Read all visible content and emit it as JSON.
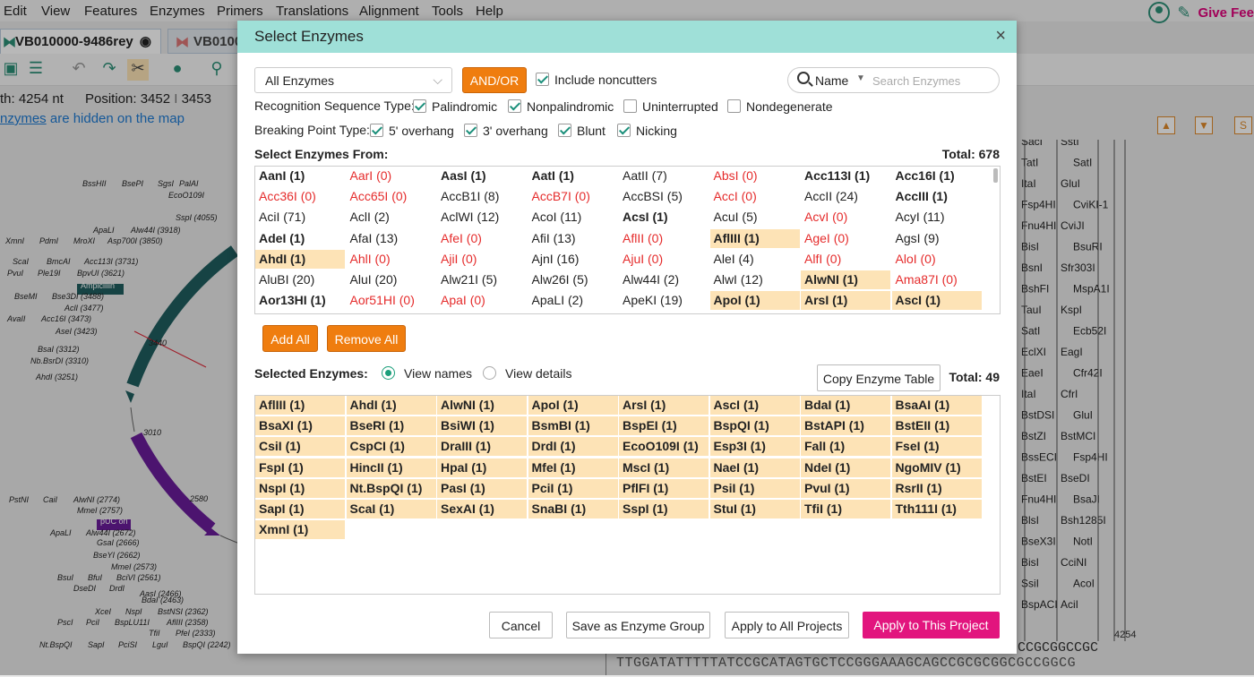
{
  "menu": [
    "Edit",
    "View",
    "Features",
    "Enzymes",
    "Primers",
    "Translations",
    "Alignment",
    "Tools",
    "Help"
  ],
  "header_right": {
    "feedback_label": "Give Fee"
  },
  "tabs": [
    "VB010000-9486rey",
    "VB0100"
  ],
  "info": {
    "length": "th: 4254 nt",
    "position": "Position: 3452",
    "position_end": "3453"
  },
  "hidden_notice": {
    "link": "nzymes",
    "rest": " are hidden on the map"
  },
  "sequence": {
    "bottom": "TTGGATATTTTTATCCGCATAGTGCTCCGGGAAAGCAGCCGCGCGGCGCCGGCG",
    "top_right": "CCGCGGCCGC",
    "length_label": "4254"
  },
  "dialog": {
    "title": "Select Enzymes",
    "close": "×",
    "dropdown_value": "All Enzymes",
    "andor_label": "AND/OR",
    "include_noncutters": "Include noncutters",
    "search_field": "Name",
    "search_placeholder": "Search Enzymes",
    "recognition_label": "Recognition Sequence Type:",
    "recognition_options": [
      {
        "label": "Palindromic",
        "checked": true
      },
      {
        "label": "Nonpalindromic",
        "checked": true
      },
      {
        "label": "Uninterrupted",
        "checked": false
      },
      {
        "label": "Nondegenerate",
        "checked": false
      }
    ],
    "breaking_label": "Breaking Point Type:",
    "breaking_options": [
      {
        "label": "5' overhang",
        "checked": true
      },
      {
        "label": "3' overhang",
        "checked": true
      },
      {
        "label": "Blunt",
        "checked": true
      },
      {
        "label": "Nicking",
        "checked": true
      }
    ],
    "select_from_label": "Select Enzymes From:",
    "select_from_total": "Total: 678",
    "enzymes_from": [
      [
        {
          "t": "AanI (1)",
          "s": "b"
        },
        {
          "t": "AarI (0)",
          "s": "r"
        },
        {
          "t": "AasI (1)",
          "s": "b"
        },
        {
          "t": "AatI (1)",
          "s": "b"
        },
        {
          "t": "AatII (7)",
          "s": ""
        },
        {
          "t": "AbsI (0)",
          "s": "r"
        },
        {
          "t": "Acc113I (1)",
          "s": "b"
        },
        {
          "t": "Acc16I (1)",
          "s": "b"
        }
      ],
      [
        {
          "t": "Acc36I (0)",
          "s": "r"
        },
        {
          "t": "Acc65I (0)",
          "s": "r"
        },
        {
          "t": "AccB1I (8)",
          "s": ""
        },
        {
          "t": "AccB7I (0)",
          "s": "r"
        },
        {
          "t": "AccBSI (5)",
          "s": ""
        },
        {
          "t": "AccI (0)",
          "s": "r"
        },
        {
          "t": "AccII (24)",
          "s": ""
        },
        {
          "t": "AccIII (1)",
          "s": "b"
        }
      ],
      [
        {
          "t": "AciI (71)",
          "s": ""
        },
        {
          "t": "AclI (2)",
          "s": ""
        },
        {
          "t": "AclWI (12)",
          "s": ""
        },
        {
          "t": "AcoI (11)",
          "s": ""
        },
        {
          "t": "AcsI (1)",
          "s": "b"
        },
        {
          "t": "AcuI (5)",
          "s": ""
        },
        {
          "t": "AcvI (0)",
          "s": "r"
        },
        {
          "t": "AcyI (11)",
          "s": ""
        }
      ],
      [
        {
          "t": "AdeI (1)",
          "s": "b"
        },
        {
          "t": "AfaI (13)",
          "s": ""
        },
        {
          "t": "AfeI (0)",
          "s": "r"
        },
        {
          "t": "AfiI (13)",
          "s": ""
        },
        {
          "t": "AflII (0)",
          "s": "r"
        },
        {
          "t": "AflIII (1)",
          "s": "bs"
        },
        {
          "t": "AgeI (0)",
          "s": "r"
        },
        {
          "t": "AgsI (9)",
          "s": ""
        }
      ],
      [
        {
          "t": "AhdI (1)",
          "s": "bs"
        },
        {
          "t": "AhlI (0)",
          "s": "r"
        },
        {
          "t": "AjiI (0)",
          "s": "r"
        },
        {
          "t": "AjnI (16)",
          "s": ""
        },
        {
          "t": "AjuI (0)",
          "s": "r"
        },
        {
          "t": "AleI (4)",
          "s": ""
        },
        {
          "t": "AlfI (0)",
          "s": "r"
        },
        {
          "t": "AloI (0)",
          "s": "r"
        }
      ],
      [
        {
          "t": "AluBI (20)",
          "s": ""
        },
        {
          "t": "AluI (20)",
          "s": ""
        },
        {
          "t": "Alw21I (5)",
          "s": ""
        },
        {
          "t": "Alw26I (5)",
          "s": ""
        },
        {
          "t": "Alw44I (2)",
          "s": ""
        },
        {
          "t": "AlwI (12)",
          "s": ""
        },
        {
          "t": "AlwNI (1)",
          "s": "bs"
        },
        {
          "t": "Ama87I (0)",
          "s": "r"
        }
      ],
      [
        {
          "t": "Aor13HI (1)",
          "s": "b"
        },
        {
          "t": "Aor51HI (0)",
          "s": "r"
        },
        {
          "t": "ApaI (0)",
          "s": "r"
        },
        {
          "t": "ApaLI (2)",
          "s": ""
        },
        {
          "t": "ApeKI (19)",
          "s": ""
        },
        {
          "t": "ApoI (1)",
          "s": "bs"
        },
        {
          "t": "ArsI (1)",
          "s": "bs"
        },
        {
          "t": "AscI (1)",
          "s": "bs"
        }
      ]
    ],
    "add_all": "Add All",
    "remove_all": "Remove All",
    "selected_label": "Selected Enzymes:",
    "view_names": "View names",
    "view_details": "View details",
    "copy_table": "Copy Enzyme Table",
    "selected_total": "Total: 49",
    "selected": [
      "AflIII (1)",
      "AhdI (1)",
      "AlwNI (1)",
      "ApoI (1)",
      "ArsI (1)",
      "AscI (1)",
      "BdaI (1)",
      "BsaAI (1)",
      "BsaXI (1)",
      "BseRI (1)",
      "BsiWI (1)",
      "BsmBI (1)",
      "BspEI (1)",
      "BspQI (1)",
      "BstAPI (1)",
      "BstEII (1)",
      "CsiI (1)",
      "CspCI (1)",
      "DraIII (1)",
      "DrdI (1)",
      "EcoO109I (1)",
      "Esp3I (1)",
      "FalI (1)",
      "FseI (1)",
      "FspI (1)",
      "HincII (1)",
      "HpaI (1)",
      "MfeI (1)",
      "MscI (1)",
      "NaeI (1)",
      "NdeI (1)",
      "NgoMIV (1)",
      "NspI (1)",
      "Nt.BspQI (1)",
      "PasI (1)",
      "PciI (1)",
      "PflFI (1)",
      "PsiI (1)",
      "PvuI (1)",
      "RsrII (1)",
      "SapI (1)",
      "ScaI (1)",
      "SexAI (1)",
      "SnaBI (1)",
      "SspI (1)",
      "StuI (1)",
      "TfiI (1)",
      "Tth111I (1)",
      "XmnI (1)"
    ],
    "footer": {
      "cancel": "Cancel",
      "save_group": "Save as Enzyme Group",
      "apply_all": "Apply to All Projects",
      "apply_this": "Apply to This Project"
    }
  },
  "map_labels": [
    "BssHII",
    "BsePI",
    "SgsI",
    "PalAI",
    "EcoO109I",
    "SspI (4055)",
    "ApaLI",
    "Alw44I (3918)",
    "XmnI",
    "PdmI",
    "MroXI",
    "Asp700I (3850)",
    "ScaI",
    "BmcAI",
    "Acc113I (3731)",
    "PvuI",
    "Ple19I",
    "BpvUI (3621)",
    "Ampicillin",
    "BseMI",
    "Bse3DI (3488)",
    "AvaII",
    "Acc16I (3473)",
    "AclI (3477)",
    "AseI (3423)",
    "BsaI (3312)",
    "Nb.BsrDI (3310)",
    "AhdI (3251)",
    "PstNI",
    "CaiI",
    "AlwNI (2774)",
    "MmeI (2757)",
    "pUC ori",
    "ApaLI",
    "Alw44I (2672)",
    "GsaI (2666)",
    "BseYI (2662)",
    "MmeI (2573)",
    "BsuI",
    "BfuI",
    "BciVI (2561)",
    "DseDI",
    "DrdI",
    "AasI (2466)",
    "BdaI (2463)",
    "XceI",
    "NspI",
    "BstNSI (2362)",
    "PscI",
    "PciI",
    "BspLU11I",
    "AflIII (2358)",
    "TfiI",
    "PfeI (2333)",
    "Nt.BspQI",
    "SapI",
    "PciSI",
    "LguI",
    "BspQI (2242)",
    "3440",
    "3010",
    "2580"
  ],
  "right_labels": [
    "SacI",
    "SstI",
    "TatI",
    "SatI",
    "ItaI",
    "GluI",
    "Fsp4HI",
    "CviKI-1",
    "Fnu4HI",
    "CviJI",
    "BisI",
    "BsuRI",
    "BsnI",
    "Sfr303I",
    "BshFI",
    "MspA1I",
    "TauI",
    "KspI",
    "SatI",
    "Ecb52I",
    "EclXI",
    "EagI",
    "EaeI",
    "Cfr42I",
    "ItaI",
    "CfrI",
    "BstDSI",
    "GluI",
    "BstZI",
    "BstMCI",
    "BssECI",
    "Fsp4HI",
    "BstEI",
    "BseDI",
    "Fnu4HI",
    "BsaJI",
    "BlsI",
    "Bsh1285I",
    "BseX3I",
    "NotI",
    "BisI",
    "CciNI",
    "SsiI",
    "AcoI",
    "BspACI",
    "AciI"
  ],
  "colors": {
    "accent_orange": "#ef7d0f",
    "dialog_header": "#9fe0d8",
    "selected_cell": "#fde3b6",
    "apply_button": "#e2157e",
    "zero_cutter": "#e52b2b",
    "check": "#1a8f7a"
  }
}
